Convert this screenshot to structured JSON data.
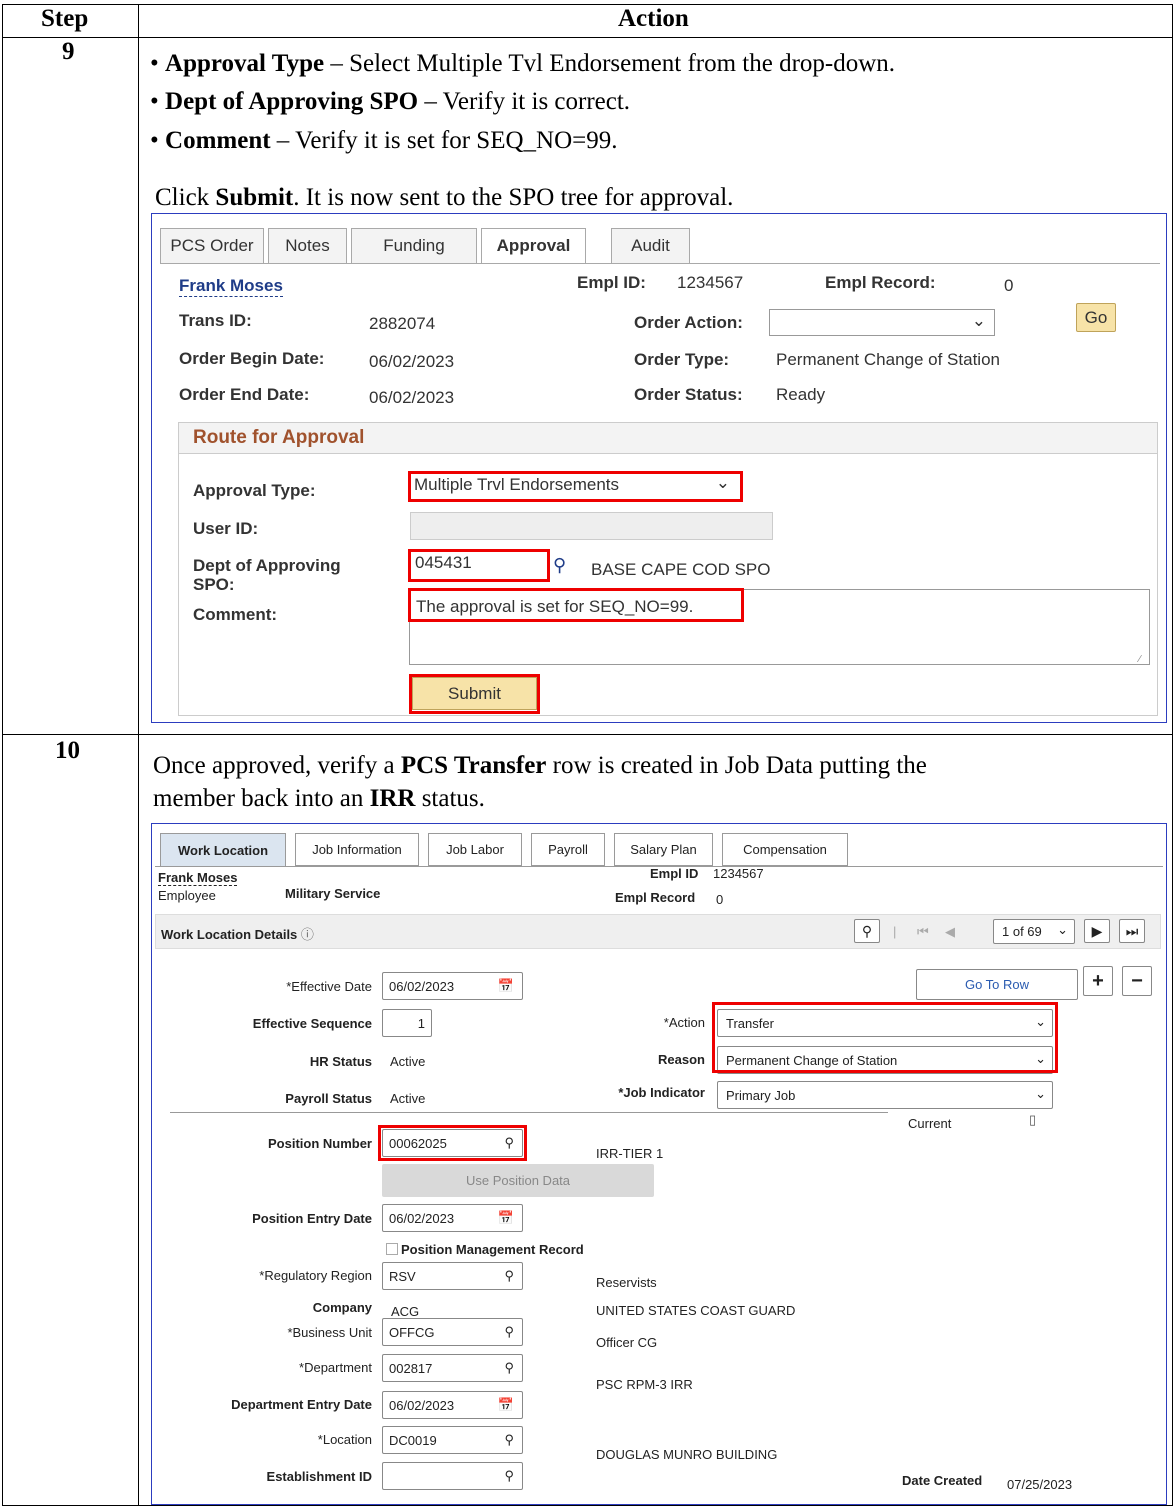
{
  "table": {
    "header_step": "Step",
    "header_action": "Action"
  },
  "step9": {
    "number": "9",
    "bullets": [
      {
        "bold": "Approval Type",
        "rest": " – Select Multiple Tvl Endorsement from the drop-down."
      },
      {
        "bold": "Dept of Approving SPO",
        "rest": " – Verify it is correct."
      },
      {
        "bold": "Comment",
        "rest": " – Verify it is set for SEQ_NO=99."
      }
    ],
    "click_pre": "Click ",
    "click_bold": "Submit",
    "click_post": ". It is now sent to the SPO tree for approval."
  },
  "shot1": {
    "tabs": [
      "PCS Order",
      "Notes",
      "Funding",
      "Approval",
      "Audit"
    ],
    "name": "Frank Moses",
    "empl_id_label": "Empl ID:",
    "empl_id": "1234567",
    "empl_record_label": "Empl Record:",
    "empl_record": "0",
    "trans_id_label": "Trans ID:",
    "trans_id": "2882074",
    "order_action_label": "Order Action:",
    "order_action_value": "",
    "go_label": "Go",
    "order_begin_label": "Order Begin Date:",
    "order_begin": "06/02/2023",
    "order_type_label": "Order Type:",
    "order_type": "Permanent Change of Station",
    "order_end_label": "Order End Date:",
    "order_end": "06/02/2023",
    "order_status_label": "Order Status:",
    "order_status": "Ready",
    "section_title": "Route for Approval",
    "approval_type_label": "Approval Type:",
    "approval_type": "Multiple Trvl Endorsements",
    "user_id_label": "User ID:",
    "user_id": "",
    "dept_label": "Dept of Approving SPO:",
    "dept_value": "045431",
    "dept_desc": "BASE CAPE COD SPO",
    "comment_label": "Comment:",
    "comment": "The approval is set for SEQ_NO=99.",
    "submit_label": "Submit"
  },
  "step10": {
    "number": "10",
    "line1_pre": "Once approved, verify a ",
    "line1_bold": "PCS Transfer",
    "line1_post": " row is created in Job Data putting the",
    "line2_pre": "member back into an ",
    "line2_bold": "IRR",
    "line2_post": " status."
  },
  "shot2": {
    "tabs": [
      "Work Location",
      "Job Information",
      "Job Labor",
      "Payroll",
      "Salary Plan",
      "Compensation"
    ],
    "name": "Frank Moses",
    "employee": "Employee",
    "service": "Military Service",
    "empl_id_label": "Empl ID",
    "empl_id": "1234567",
    "empl_record_label": "Empl Record",
    "empl_record": "0",
    "section_title": "Work Location Details",
    "pager": "1 of 69",
    "go_to_row": "Go To Row",
    "effective_date_label": "*Effective Date",
    "effective_date": "06/02/2023",
    "effective_seq_label": "Effective Sequence",
    "effective_seq": "1",
    "hr_status_label": "HR Status",
    "hr_status": "Active",
    "payroll_status_label": "Payroll Status",
    "payroll_status": "Active",
    "action_label": "*Action",
    "action": "Transfer",
    "reason_label": "Reason",
    "reason": "Permanent Change of Station",
    "job_indicator_label": "*Job Indicator",
    "job_indicator": "Primary Job",
    "current": "Current",
    "position_number_label": "Position Number",
    "position_number": "00062025",
    "position_desc": "IRR-TIER 1",
    "use_position_data": "Use Position Data",
    "position_entry_label": "Position Entry Date",
    "position_entry": "06/02/2023",
    "position_mgmt": "Position Management Record",
    "reg_region_label": "*Regulatory Region",
    "reg_region": "RSV",
    "reg_region_desc": "Reservists",
    "company_label": "Company",
    "company": "ACG",
    "company_desc": "UNITED STATES COAST GUARD",
    "business_unit_label": "*Business Unit",
    "business_unit": "OFFCG",
    "business_unit_desc": "Officer CG",
    "department_label": "*Department",
    "department": "002817",
    "department_desc": "PSC RPM-3 IRR",
    "dept_entry_label": "Department Entry Date",
    "dept_entry": "06/02/2023",
    "location_label": "*Location",
    "location": "DC0019",
    "location_desc": "DOUGLAS MUNRO BUILDING",
    "establishment_label": "Establishment ID",
    "establishment": "",
    "date_created_label": "Date Created",
    "date_created": "07/25/2023"
  }
}
